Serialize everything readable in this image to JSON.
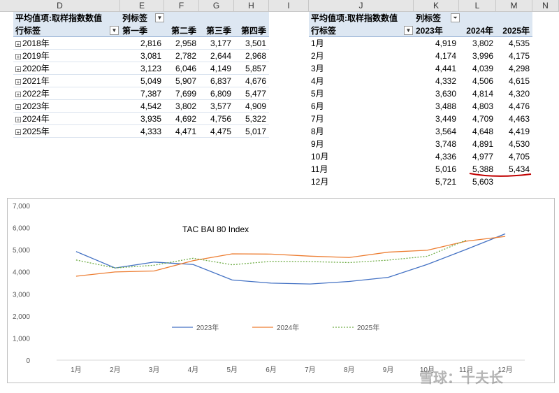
{
  "columns": [
    "D",
    "E",
    "F",
    "G",
    "H",
    "I",
    "J",
    "K",
    "L",
    "M",
    "N"
  ],
  "pivot1": {
    "value_label": "平均值项:取样指数数值",
    "col_label": "列标签",
    "row_label": "行标签",
    "headers": [
      "第一季",
      "第二季",
      "第三季",
      "第四季"
    ],
    "rows": [
      {
        "label": "2018年",
        "values": [
          "2,816",
          "2,958",
          "3,177",
          "3,501"
        ]
      },
      {
        "label": "2019年",
        "values": [
          "3,081",
          "2,782",
          "2,644",
          "2,968"
        ]
      },
      {
        "label": "2020年",
        "values": [
          "3,123",
          "6,046",
          "4,149",
          "5,857"
        ]
      },
      {
        "label": "2021年",
        "values": [
          "5,049",
          "5,907",
          "6,837",
          "4,676"
        ]
      },
      {
        "label": "2022年",
        "values": [
          "7,387",
          "7,699",
          "6,809",
          "5,477"
        ]
      },
      {
        "label": "2023年",
        "values": [
          "4,542",
          "3,802",
          "3,577",
          "4,909"
        ]
      },
      {
        "label": "2024年",
        "values": [
          "3,935",
          "4,692",
          "4,756",
          "5,322"
        ]
      },
      {
        "label": "2025年",
        "values": [
          "4,333",
          "4,471",
          "4,475",
          "5,017"
        ]
      }
    ]
  },
  "pivot2": {
    "value_label": "平均值项:取样指数数值",
    "col_label": "列标签",
    "row_label": "行标签",
    "headers": [
      "2023年",
      "2024年",
      "2025年"
    ],
    "rows": [
      {
        "label": "1月",
        "values": [
          "4,919",
          "3,802",
          "4,535"
        ]
      },
      {
        "label": "2月",
        "values": [
          "4,174",
          "3,996",
          "4,175"
        ]
      },
      {
        "label": "3月",
        "values": [
          "4,441",
          "4,039",
          "4,298"
        ]
      },
      {
        "label": "4月",
        "values": [
          "4,332",
          "4,506",
          "4,615"
        ]
      },
      {
        "label": "5月",
        "values": [
          "3,630",
          "4,814",
          "4,320"
        ]
      },
      {
        "label": "6月",
        "values": [
          "3,488",
          "4,803",
          "4,476"
        ]
      },
      {
        "label": "7月",
        "values": [
          "3,449",
          "4,709",
          "4,463"
        ]
      },
      {
        "label": "8月",
        "values": [
          "3,564",
          "4,648",
          "4,419"
        ]
      },
      {
        "label": "9月",
        "values": [
          "3,748",
          "4,891",
          "4,530"
        ]
      },
      {
        "label": "10月",
        "values": [
          "4,336",
          "4,977",
          "4,705"
        ]
      },
      {
        "label": "11月",
        "values": [
          "5,016",
          "5,388",
          "5,434"
        ]
      },
      {
        "label": "12月",
        "values": [
          "5,721",
          "5,603",
          ""
        ]
      }
    ]
  },
  "colors": {
    "s2023": "#4472c4",
    "s2024": "#ed7d31",
    "s2025": "#70ad47",
    "underline": "#c00000"
  },
  "chart_data": {
    "type": "line",
    "title": "TAC BAI 80 Index",
    "categories": [
      "1月",
      "2月",
      "3月",
      "4月",
      "5月",
      "6月",
      "7月",
      "8月",
      "9月",
      "10月",
      "11月",
      "12月"
    ],
    "ylim": [
      0,
      7000
    ],
    "yticks": [
      "0",
      "1,000",
      "2,000",
      "3,000",
      "4,000",
      "5,000",
      "6,000",
      "7,000"
    ],
    "series": [
      {
        "name": "2023年",
        "values": [
          4919,
          4174,
          4441,
          4332,
          3630,
          3488,
          3449,
          3564,
          3748,
          4336,
          5016,
          5721
        ]
      },
      {
        "name": "2024年",
        "values": [
          3802,
          3996,
          4039,
          4506,
          4814,
          4803,
          4709,
          4648,
          4891,
          4977,
          5388,
          5603
        ]
      },
      {
        "name": "2025年",
        "values": [
          4535,
          4175,
          4298,
          4615,
          4320,
          4476,
          4463,
          4419,
          4530,
          4705,
          5434
        ]
      }
    ],
    "legend": "inside-bottom"
  },
  "watermark": "雪球：十夫长"
}
